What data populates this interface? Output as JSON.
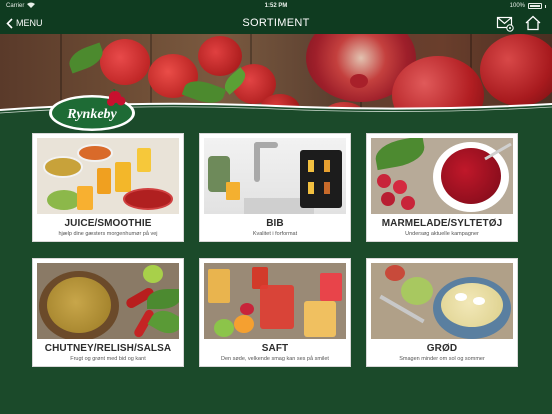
{
  "status_bar": {
    "carrier": "Carrier",
    "time": "1:52 PM",
    "battery": "100%"
  },
  "nav": {
    "back_label": "MENU",
    "title": "SORTIMENT"
  },
  "logo": {
    "text": "Rynkeby"
  },
  "categories": [
    {
      "title": "JUICE/SMOOTHIE",
      "subtitle": "hjælp dine gæsters morgenhumør på vej"
    },
    {
      "title": "BIB",
      "subtitle": "Kvalitet i forformat"
    },
    {
      "title": "MARMELADE/SYLTETØJ",
      "subtitle": "Undersøg aktuelle kampagner"
    },
    {
      "title": "CHUTNEY/RELISH/SALSA",
      "subtitle": "Frugt og grønt med bid og kant"
    },
    {
      "title": "SAFT",
      "subtitle": "Den søde, velkende smag kan ses på smilet"
    },
    {
      "title": "GRØD",
      "subtitle": "Smagen minder om sol og sommer"
    }
  ],
  "colors": {
    "background": "#1b4a2a",
    "navbar": "#0f3b20",
    "brand_red": "#c8102e",
    "brand_green": "#1e6b35"
  }
}
